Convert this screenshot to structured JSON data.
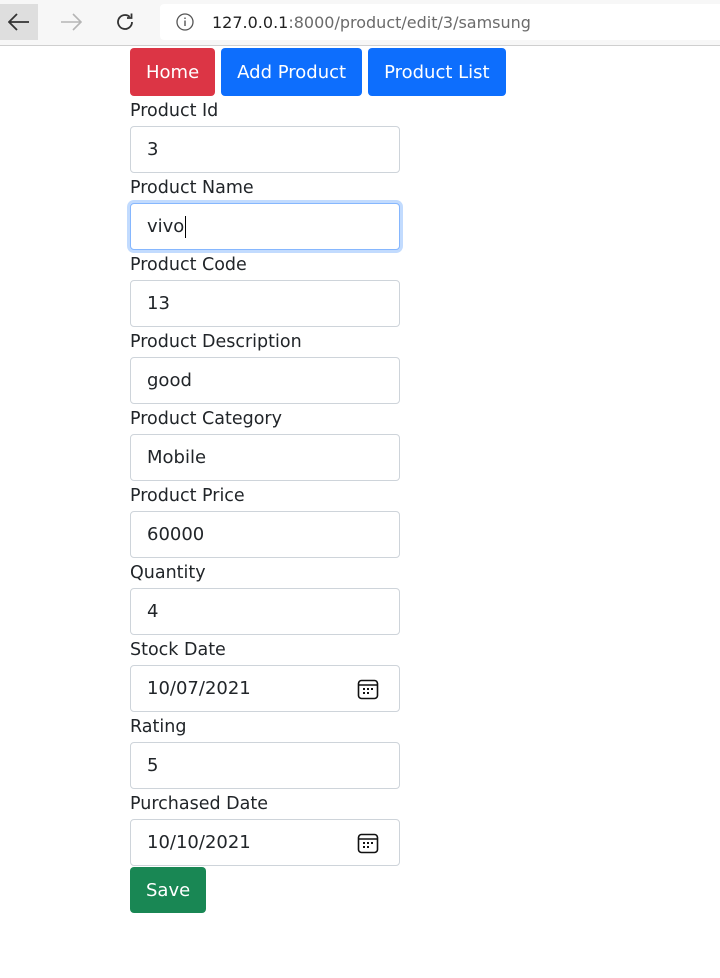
{
  "browser": {
    "url_host": "127.0.0.1",
    "url_path": ":8000/product/edit/3/samsung"
  },
  "nav": {
    "home": "Home",
    "add_product": "Add Product",
    "product_list": "Product List"
  },
  "form": {
    "product_id": {
      "label": "Product Id",
      "value": "3"
    },
    "product_name": {
      "label": "Product Name",
      "value": "vivo"
    },
    "product_code": {
      "label": "Product Code",
      "value": "13"
    },
    "product_description": {
      "label": "Product Description",
      "value": "good"
    },
    "product_category": {
      "label": "Product Category",
      "value": "Mobile"
    },
    "product_price": {
      "label": "Product Price",
      "value": "60000"
    },
    "quantity": {
      "label": "Quantity",
      "value": "4"
    },
    "stock_date": {
      "label": "Stock Date",
      "value": "10/07/2021"
    },
    "rating": {
      "label": "Rating",
      "value": "5"
    },
    "purchased_date": {
      "label": "Purchased Date",
      "value": "10/10/2021"
    },
    "save_label": "Save"
  },
  "colors": {
    "home_button": "#dc3545",
    "nav_button": "#0d6efd",
    "save_button": "#198754"
  }
}
